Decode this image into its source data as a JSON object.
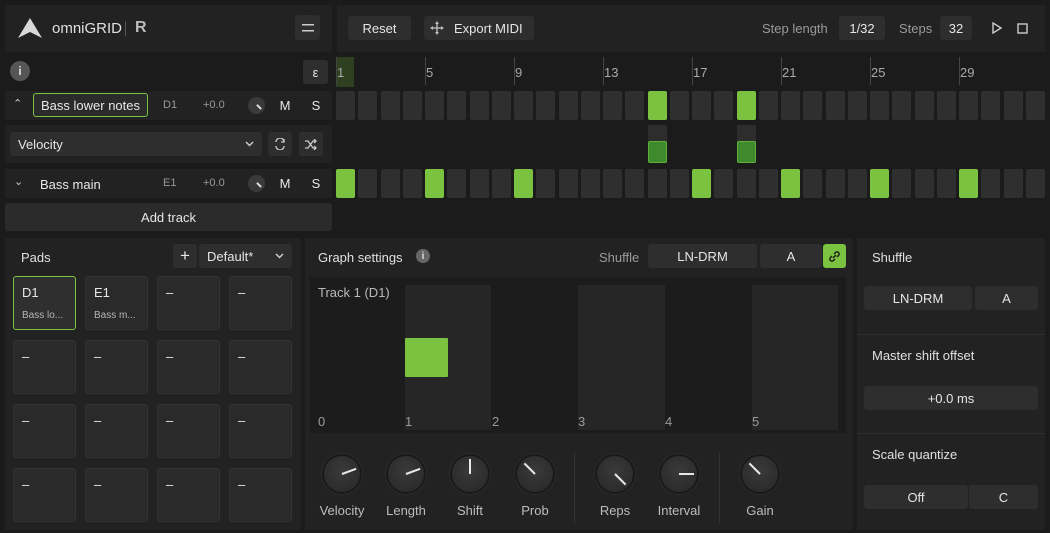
{
  "app": {
    "name": "omniGRID",
    "suffix": "R"
  },
  "toolbar": {
    "reset_label": "Reset",
    "export_label": "Export MIDI",
    "step_length_label": "Step length",
    "step_length_value": "1/32",
    "steps_label": "Steps",
    "steps_value": "32"
  },
  "ruler": {
    "numbers": [
      "1",
      "5",
      "9",
      "13",
      "17",
      "21",
      "25",
      "29"
    ],
    "epsilon": "ε"
  },
  "tracks": [
    {
      "name": "Bass lower notes",
      "note": "D1",
      "offset": "+0.0",
      "mute": "M",
      "solo": "S",
      "active_steps": [
        15,
        19
      ]
    },
    {
      "name": "Bass main",
      "note": "E1",
      "offset": "+0.0",
      "mute": "M",
      "solo": "S",
      "active_steps": [
        1,
        5,
        9,
        17,
        21,
        25,
        29
      ]
    }
  ],
  "velocity": {
    "label": "Velocity",
    "active_steps": [
      15,
      19
    ]
  },
  "add_track_label": "Add track",
  "pads": {
    "title": "Pads",
    "add": "+",
    "preset": "Default*",
    "items": [
      {
        "title": "D1",
        "sub": "Bass lo..."
      },
      {
        "title": "E1",
        "sub": "Bass m..."
      },
      {
        "title": "–",
        "sub": ""
      },
      {
        "title": "–",
        "sub": ""
      },
      {
        "title": "–",
        "sub": ""
      },
      {
        "title": "–",
        "sub": ""
      },
      {
        "title": "–",
        "sub": ""
      },
      {
        "title": "–",
        "sub": ""
      },
      {
        "title": "–",
        "sub": ""
      },
      {
        "title": "–",
        "sub": ""
      },
      {
        "title": "–",
        "sub": ""
      },
      {
        "title": "–",
        "sub": ""
      },
      {
        "title": "–",
        "sub": ""
      },
      {
        "title": "–",
        "sub": ""
      },
      {
        "title": "–",
        "sub": ""
      },
      {
        "title": "–",
        "sub": ""
      }
    ]
  },
  "graph": {
    "title": "Graph settings",
    "shuffle_label": "Shuffle",
    "shuffle_value": "LN-DRM",
    "shuffle_variant": "A",
    "track_label": "Track 1 (D1)",
    "axis": [
      "0",
      "1",
      "2",
      "3",
      "4",
      "5"
    ]
  },
  "knobs": [
    {
      "label": "Velocity",
      "angle": 70
    },
    {
      "label": "Length",
      "angle": 70
    },
    {
      "label": "Shift",
      "angle": 0
    },
    {
      "label": "Prob",
      "angle": -45
    },
    {
      "label": "Reps",
      "angle": 135
    },
    {
      "label": "Interval",
      "angle": 90
    },
    {
      "label": "Gain",
      "angle": -45
    }
  ],
  "side": {
    "shuffle_title": "Shuffle",
    "shuffle_value": "LN-DRM",
    "shuffle_variant": "A",
    "master_title": "Master shift offset",
    "master_value": "+0.0 ms",
    "scale_title": "Scale quantize",
    "scale_value": "Off",
    "scale_key": "C"
  },
  "colors": {
    "accent": "#7cc241",
    "background": "#1b1b1b",
    "panel": "#242424"
  }
}
